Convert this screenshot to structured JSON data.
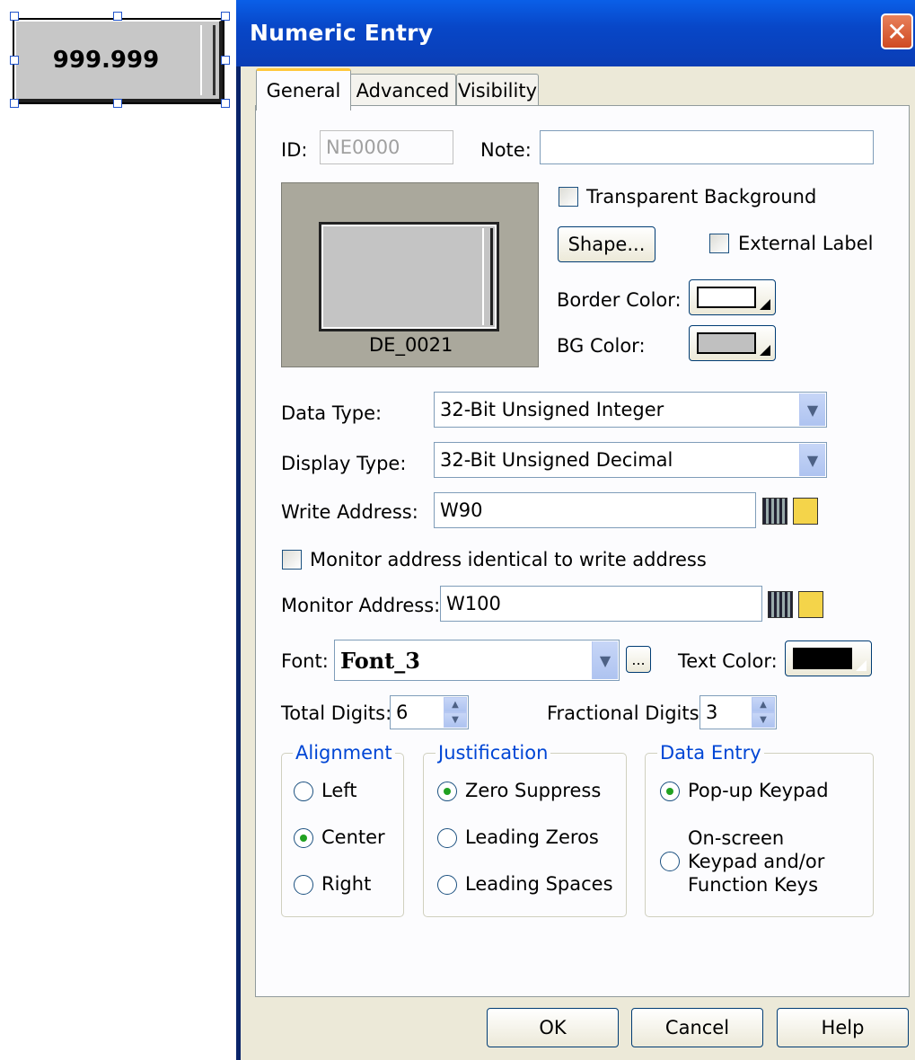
{
  "canvas_object": {
    "value": "999.999"
  },
  "dialog": {
    "title": "Numeric Entry",
    "close_label": "✕"
  },
  "tabs": [
    {
      "label": "General"
    },
    {
      "label": "Advanced"
    },
    {
      "label": "Visibility"
    }
  ],
  "general": {
    "id_label": "ID:",
    "id_value": "NE0000",
    "note_label": "Note:",
    "note_value": "",
    "preview_caption": "DE_0021",
    "transparent_bg_label": "Transparent Background",
    "shape_button": "Shape...",
    "external_label": "External Label",
    "border_color_label": "Border Color:",
    "bg_color_label": "BG Color:",
    "data_type_label": "Data Type:",
    "data_type_value": "32-Bit Unsigned Integer",
    "display_type_label": "Display Type:",
    "display_type_value": "32-Bit Unsigned Decimal",
    "write_address_label": "Write Address:",
    "write_address_value": "W90",
    "monitor_identical_label": "Monitor address identical to write address",
    "monitor_address_label": "Monitor Address:",
    "monitor_address_value": "W100",
    "font_label": "Font:",
    "font_value": "Font_3",
    "font_browse": "...",
    "text_color_label": "Text Color:",
    "total_digits_label": "Total Digits:",
    "total_digits_value": "6",
    "fractional_digits_label": "Fractional Digits:",
    "fractional_digits_value": "3"
  },
  "colors": {
    "border_color": "#ffffff",
    "bg_color": "#c0c0c0",
    "text_color": "#000000"
  },
  "alignment": {
    "title": "Alignment",
    "options": [
      "Left",
      "Center",
      "Right"
    ],
    "selected": "Center"
  },
  "justification": {
    "title": "Justification",
    "options": [
      "Zero Suppress",
      "Leading Zeros",
      "Leading Spaces"
    ],
    "selected": "Zero Suppress"
  },
  "data_entry": {
    "title": "Data Entry",
    "option1": "Pop-up Keypad",
    "option2": "On-screen Keypad and/or Function Keys",
    "selected": "Pop-up Keypad"
  },
  "buttons": {
    "ok": "OK",
    "cancel": "Cancel",
    "help": "Help"
  }
}
